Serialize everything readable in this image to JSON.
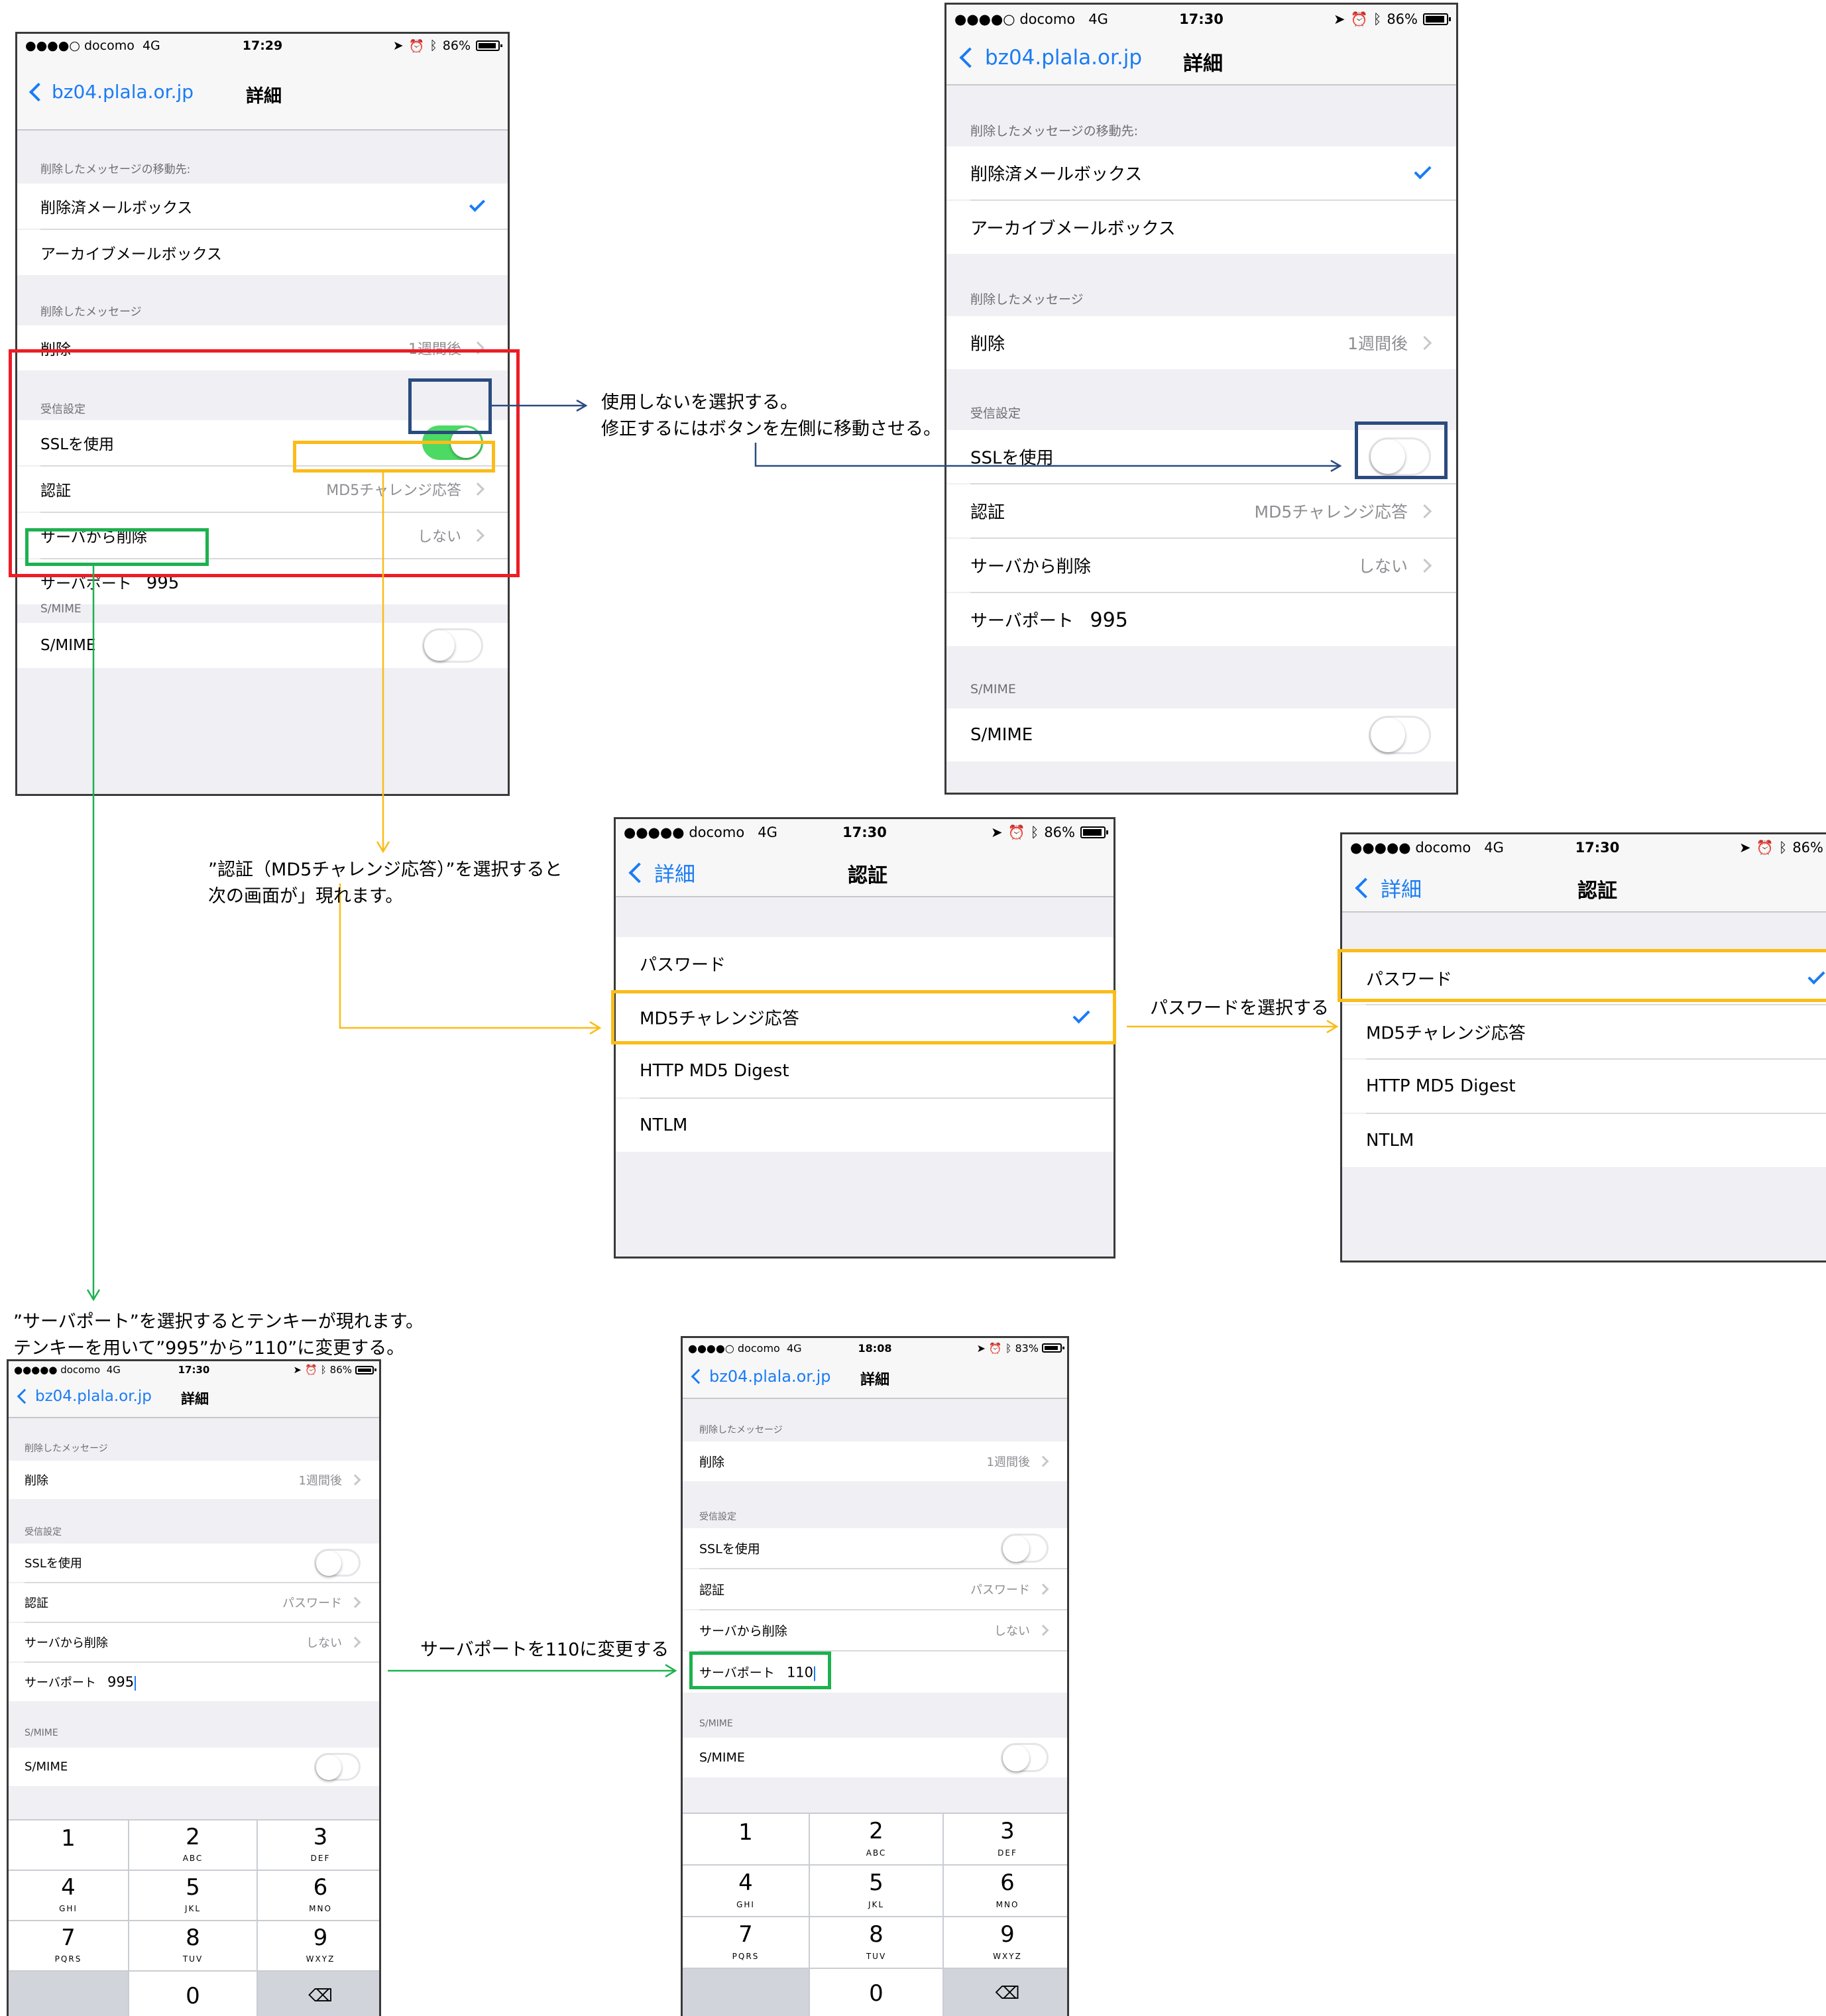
{
  "annotations": {
    "ssl_note_line1": "使用しないを選択する。",
    "ssl_note_line2": "修正するにはボタンを左側に移動させる。",
    "auth_note_line1": "”認証（MD5チャレンジ応答）”を選択すると",
    "auth_note_line2": "次の画面が」現れます。",
    "password_note": "パスワードを選択する",
    "port_note_line1": "”サーバポート”を選択するとテンキーが現れます。",
    "port_note_line2": "テンキーを用いて”995”から”110”に変更する。",
    "port_change_note": "サーバポートを110に変更する"
  },
  "common": {
    "carrier": "docomo",
    "network": "4G",
    "battery_86": "86%",
    "battery_83": "83%",
    "time_1729": "17:29",
    "time_1730": "17:30",
    "time_1808": "18:08",
    "back_account": "bz04.plala.or.jp",
    "back_detail": "詳細",
    "title_detail": "詳細",
    "title_auth": "認証",
    "hdr_move_to": "削除したメッセージの移動先:",
    "deleted_mailbox": "削除済メールボックス",
    "archive_mailbox": "アーカイブメールボックス",
    "hdr_deleted_msgs": "削除したメッセージ",
    "delete": "削除",
    "one_week": "1週間後",
    "hdr_incoming": "受信設定",
    "use_ssl": "SSLを使用",
    "auth": "認証",
    "md5": "MD5チャレンジ応答",
    "delete_from_server": "サーバから削除",
    "never": "しない",
    "server_port": "サーバポート",
    "port_995": "995",
    "port_110": "110",
    "hdr_smime": "S/MIME",
    "smime": "S/MIME",
    "password": "パスワード",
    "http_md5": "HTTP MD5 Digest",
    "ntlm": "NTLM"
  },
  "keypad": {
    "k1": "1",
    "k2": "2",
    "k2l": "ABC",
    "k3": "3",
    "k3l": "DEF",
    "k4": "4",
    "k4l": "GHI",
    "k5": "5",
    "k5l": "JKL",
    "k6": "6",
    "k6l": "MNO",
    "k7": "7",
    "k7l": "PQRS",
    "k8": "8",
    "k8l": "TUV",
    "k9": "9",
    "k9l": "WXYZ",
    "k0": "0"
  },
  "colors": {
    "ios_blue": "#1a7cf5",
    "toggle_green": "#4cd964",
    "annot_red": "#ee1c25",
    "annot_navy": "#2b4b7e",
    "annot_yellow": "#fbbc1a",
    "annot_green": "#1db14f"
  }
}
